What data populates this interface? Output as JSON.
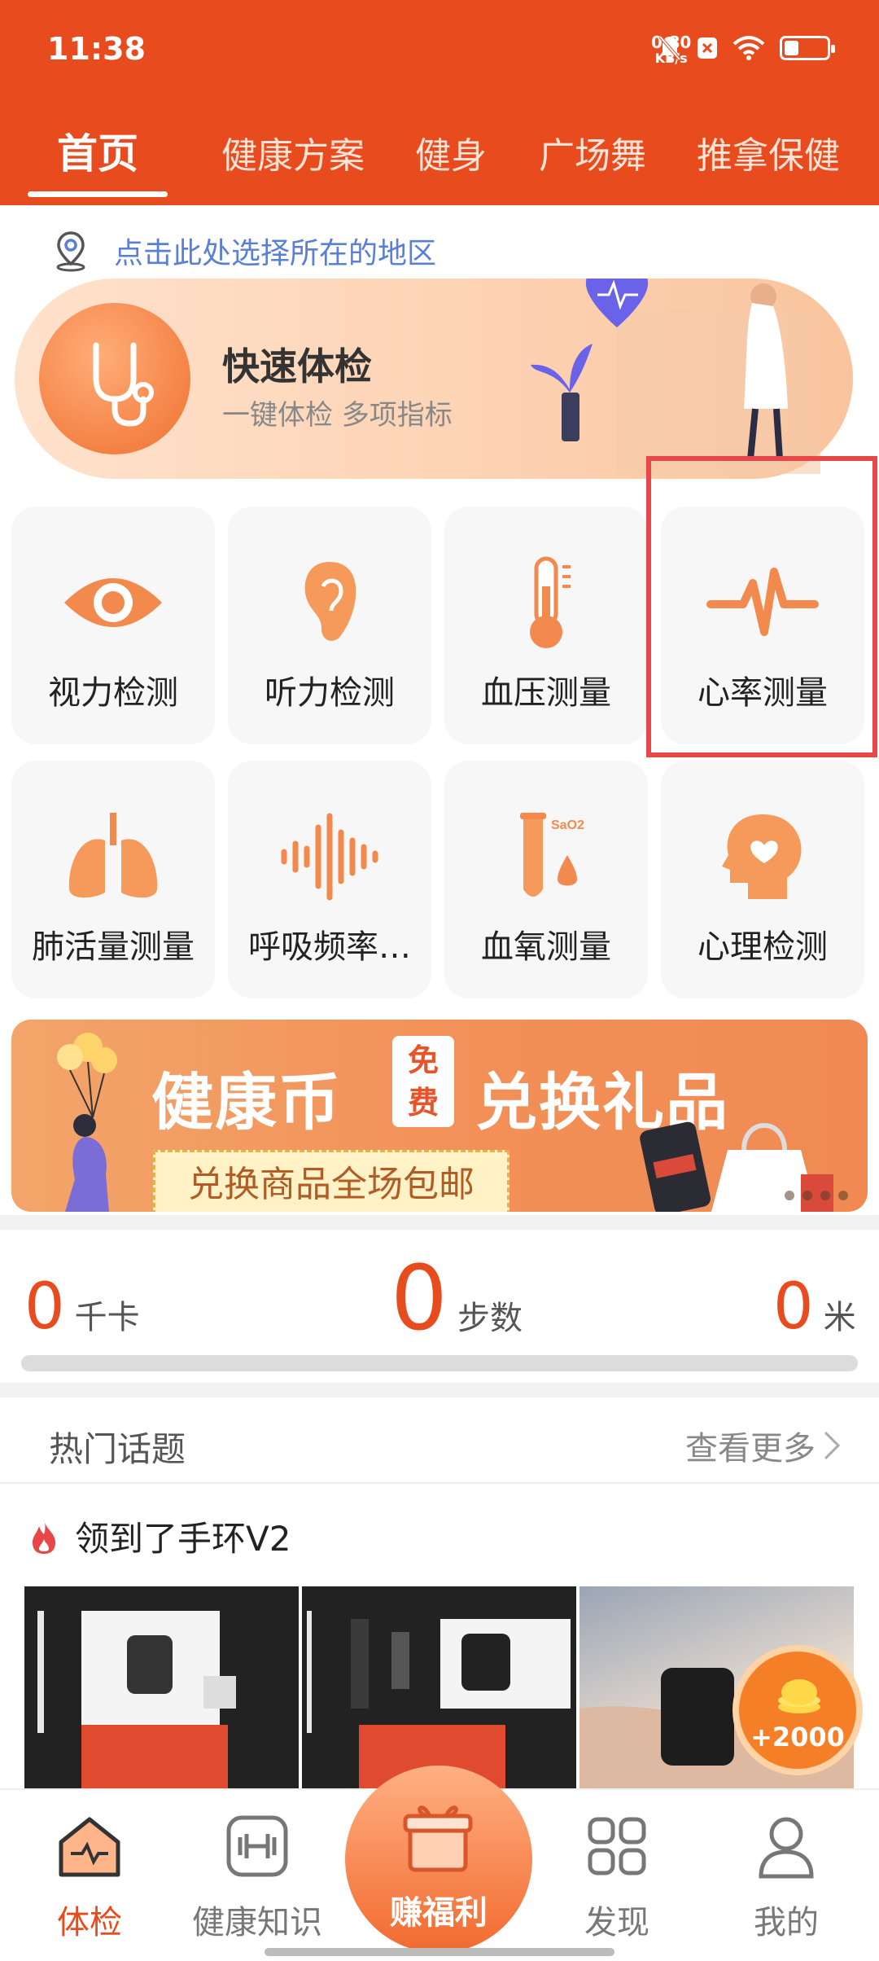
{
  "status_bar": {
    "time": "11:38",
    "net_speed_value": "0.80",
    "net_speed_unit": "KB/s"
  },
  "top_tabs": [
    {
      "label": "首页",
      "active": true
    },
    {
      "label": "健康方案",
      "active": false
    },
    {
      "label": "健身",
      "active": false
    },
    {
      "label": "广场舞",
      "active": false
    },
    {
      "label": "推拿保健",
      "active": false
    }
  ],
  "location": {
    "text": "点击此处选择所在的地区",
    "icon": "location-pin-icon"
  },
  "quick_check": {
    "title": "快速体检",
    "subtitle": "一键体检 多项指标",
    "icon": "stethoscope-icon"
  },
  "tools": [
    {
      "label": "视力检测",
      "icon": "eye-icon"
    },
    {
      "label": "听力检测",
      "icon": "ear-icon"
    },
    {
      "label": "血压测量",
      "icon": "thermometer-icon"
    },
    {
      "label": "心率测量",
      "icon": "heartbeat-icon"
    },
    {
      "label": "肺活量测量",
      "icon": "lungs-icon"
    },
    {
      "label": "呼吸频率…",
      "icon": "soundwave-icon"
    },
    {
      "label": "血氧测量",
      "icon": "test-tube-drop-icon",
      "badge": "SaO2"
    },
    {
      "label": "心理检测",
      "icon": "head-heart-icon"
    }
  ],
  "banner": {
    "headline_left": "健康币",
    "free_tag_top": "免",
    "free_tag_bottom": "费",
    "headline_right": "兑换礼品",
    "subline": "兑换商品全场包邮"
  },
  "activity": {
    "calories_value": "0",
    "calories_unit": "千卡",
    "steps_value": "0",
    "steps_unit": "步数",
    "distance_value": "0",
    "distance_unit": "米",
    "progress": 0
  },
  "topics": {
    "title": "热门话题",
    "more": "查看更多",
    "post_title": "领到了手环V2"
  },
  "reward": {
    "amount": "+2000"
  },
  "bottom_nav": [
    {
      "label": "体检",
      "icon": "heart-house-icon",
      "active": true
    },
    {
      "label": "健康知识",
      "icon": "dumbbell-icon",
      "active": false
    },
    {
      "label": "赚福利",
      "icon": "gift-icon",
      "active": false
    },
    {
      "label": "发现",
      "icon": "grid-apps-icon",
      "active": false
    },
    {
      "label": "我的",
      "icon": "user-icon",
      "active": false
    }
  ],
  "colors": {
    "brand": "#e84c1e",
    "accent": "#f07030",
    "link": "#5a7fd6",
    "highlight": "#e8474a"
  }
}
